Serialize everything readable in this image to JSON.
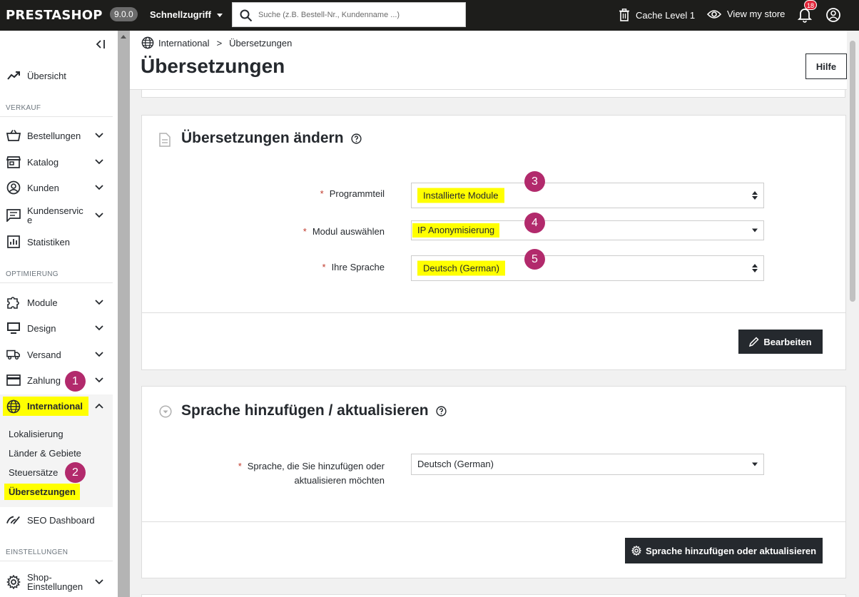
{
  "topbar": {
    "logo": "PRESTASHOP",
    "version": "9.0.0",
    "quick_access": "Schnellzugriff",
    "search_placeholder": "Suche (z.B. Bestell-Nr., Kundenname ...)",
    "cache": "Cache Level 1",
    "view_store": "View my store",
    "notifications_count": "18"
  },
  "sidebar": {
    "overview": "Übersicht",
    "section_sales": "VERKAUF",
    "orders": "Bestellungen",
    "catalog": "Katalog",
    "customers": "Kunden",
    "customer_service": "Kundenservic e",
    "statistics": "Statistiken",
    "section_improve": "OPTIMIERUNG",
    "modules": "Module",
    "design": "Design",
    "shipping": "Versand",
    "payment": "Zahlung",
    "international": "International",
    "sub_localization": "Lokalisierung",
    "sub_countries": "Länder & Gebiete",
    "sub_taxes": "Steuersätze",
    "sub_translations": "Übersetzungen",
    "seo": "SEO Dashboard",
    "section_settings": "EINSTELLUNGEN",
    "shop_settings": "Shop-Einstellungen"
  },
  "header": {
    "breadcrumb_parent": "International",
    "breadcrumb_sep": ">",
    "breadcrumb_current": "Übersetzungen",
    "title": "Übersetzungen",
    "help": "Hilfe"
  },
  "modify_card": {
    "title": "Übersetzungen ändern",
    "label_type": "Programmteil",
    "value_type": "Installierte Module",
    "label_module": "Modul auswählen",
    "value_module": "IP Anonymisierung",
    "label_language": "Ihre Sprache",
    "value_language": "Deutsch (German)",
    "edit_button": "Bearbeiten"
  },
  "add_card": {
    "title": "Sprache hinzufügen / aktualisieren",
    "label_line1": "Sprache, die Sie hinzufügen oder",
    "label_line2": "aktualisieren möchten",
    "value": "Deutsch (German)",
    "button": "Sprache hinzufügen oder aktualisieren"
  },
  "steps": [
    "1",
    "2",
    "3",
    "4",
    "5"
  ],
  "colors": {
    "highlight": "#ffff00",
    "step_badge": "#b22a6c",
    "topbar": "#1d1d1b",
    "dark_button": "#25292e"
  }
}
